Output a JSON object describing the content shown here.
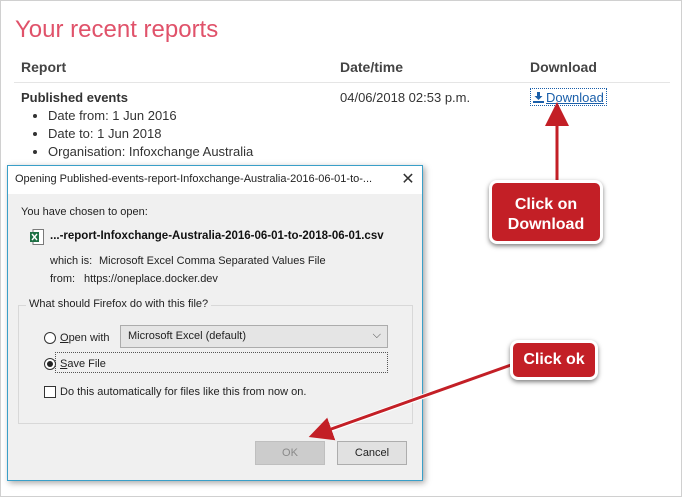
{
  "page": {
    "title": "Your recent reports",
    "columns": [
      "Report",
      "Date/time",
      "Download"
    ],
    "report": {
      "name": "Published events",
      "details": [
        "Date from: 1 Jun 2016",
        "Date to: 1 Jun 2018",
        "Organisation: Infoxchange Australia"
      ],
      "datetime": "04/06/2018 02:53 p.m.",
      "download_label": "Download",
      "download_icon": "download-icon"
    }
  },
  "dialog": {
    "title": "Opening Published-events-report-Infoxchange-Australia-2016-06-01-to-...",
    "close_icon": "close-icon",
    "chosen_text": "You have chosen to open:",
    "file_icon": "excel-csv-file-icon",
    "file_name": "...-report-Infoxchange-Australia-2016-06-01-to-2018-06-01.csv",
    "which_label": "which is:",
    "which_value": "Microsoft Excel Comma Separated Values File",
    "from_label": "from:",
    "from_value": "https://oneplace.docker.dev",
    "question": "What should Firefox do with this file?",
    "open_with_label": "Open with",
    "open_with_app": "Microsoft Excel (default)",
    "save_file_label": "Save File",
    "selected_option": "save_file",
    "auto_label": "Do this automatically for files like this from now on.",
    "auto_checked": false,
    "ok_label": "OK",
    "cancel_label": "Cancel"
  },
  "annotations": {
    "download_callout": "Click on\nDownload",
    "download_callout_lines": [
      "Click on",
      "Download"
    ],
    "ok_callout": "Click ok",
    "color": "#c31f26"
  }
}
